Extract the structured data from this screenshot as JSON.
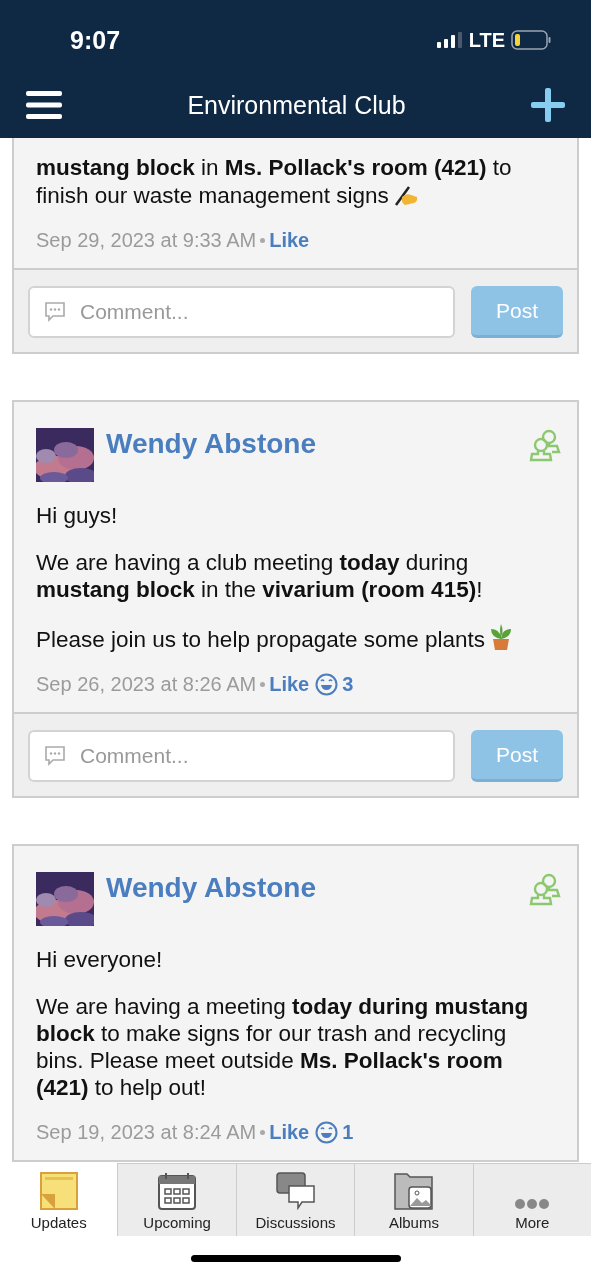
{
  "status_bar": {
    "time": "9:07",
    "network": "LTE"
  },
  "header": {
    "title": "Environmental Club"
  },
  "posts": [
    {
      "paragraphs": [
        "**mustang block** in **Ms. Pollack's room (421)** to finish our waste management signs"
      ],
      "date": "Sep 29, 2023 at 9:33 AM",
      "like": "Like",
      "comment": {
        "placeholder": "Comment...",
        "button": "Post"
      }
    },
    {
      "author": "Wendy Abstone",
      "paragraphs": [
        "Hi guys!",
        "We are having a club meeting **today** during **mustang block** in the **vivarium (room 415)**!",
        "Please join us to help propagate some plants"
      ],
      "date": "Sep 26, 2023 at 8:26 AM",
      "like": "Like",
      "reactions": "3",
      "comment": {
        "placeholder": "Comment...",
        "button": "Post"
      }
    },
    {
      "author": "Wendy Abstone",
      "paragraphs": [
        "Hi everyone!",
        "We are having a meeting **today during mustang block** to make signs for our trash and recycling bins. Please meet outside **Ms. Pollack's room (421)** to help out!"
      ],
      "date": "Sep 19, 2023 at 8:24 AM",
      "like": "Like",
      "reactions": "1"
    }
  ],
  "tabs": [
    {
      "label": "Updates",
      "selected": true
    },
    {
      "label": "Upcoming",
      "selected": false
    },
    {
      "label": "Discussions",
      "selected": false
    },
    {
      "label": "Albums",
      "selected": false
    },
    {
      "label": "More",
      "selected": false
    }
  ]
}
